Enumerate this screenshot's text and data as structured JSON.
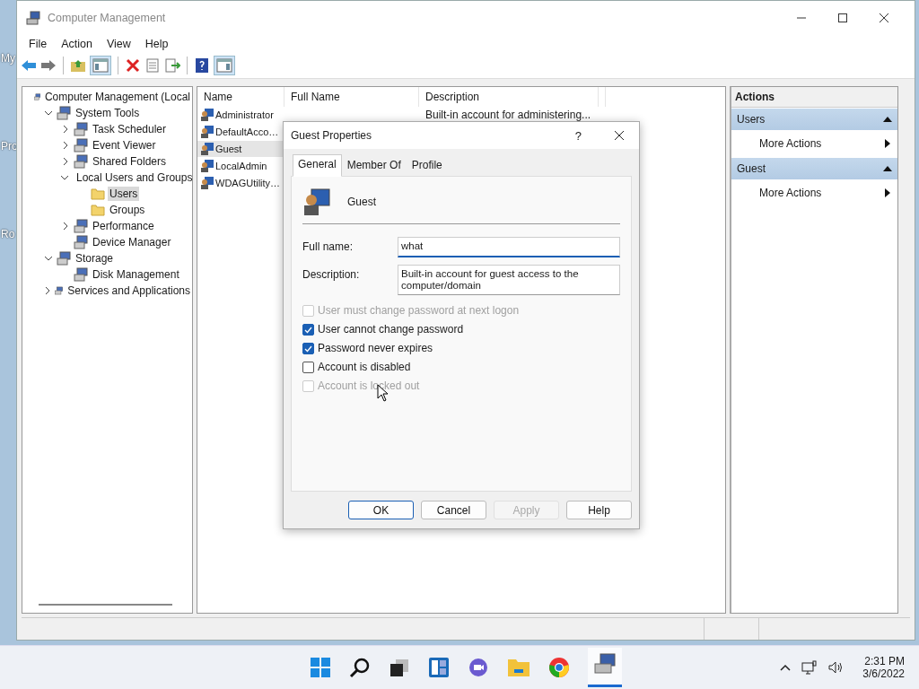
{
  "desktop_icons": [
    {
      "label": "My"
    },
    {
      "label": "Pro"
    },
    {
      "label": "Ro"
    }
  ],
  "window": {
    "title": "Computer Management"
  },
  "menu": [
    "File",
    "Action",
    "View",
    "Help"
  ],
  "tree": [
    {
      "label": "Computer Management (Local",
      "selected": false,
      "children": [
        {
          "label": "System Tools",
          "expanded": true,
          "selected": false,
          "children": [
            {
              "label": "Task Scheduler",
              "expanded": false,
              "selected": false
            },
            {
              "label": "Event Viewer",
              "expanded": false,
              "selected": false
            },
            {
              "label": "Shared Folders",
              "expanded": false,
              "selected": false
            },
            {
              "label": "Local Users and Groups",
              "expanded": true,
              "selected": false,
              "children": [
                {
                  "label": "Users",
                  "selected": true
                },
                {
                  "label": "Groups",
                  "selected": false
                }
              ]
            },
            {
              "label": "Performance",
              "expanded": false,
              "selected": false
            },
            {
              "label": "Device Manager",
              "selected": false
            }
          ]
        },
        {
          "label": "Storage",
          "expanded": true,
          "selected": false,
          "children": [
            {
              "label": "Disk Management",
              "selected": false
            }
          ]
        },
        {
          "label": "Services and Applications",
          "expanded": false,
          "selected": false
        }
      ]
    }
  ],
  "list": {
    "columns": [
      "Name",
      "Full Name",
      "Description"
    ],
    "rows": [
      {
        "name": "Administrator",
        "description": "Built-in account for administering...",
        "selected": false
      },
      {
        "name": "DefaultAcco…",
        "selected": false
      },
      {
        "name": "Guest",
        "selected": true
      },
      {
        "name": "LocalAdmin",
        "selected": false
      },
      {
        "name": "WDAGUtility…",
        "selected": false
      }
    ]
  },
  "actions": {
    "title": "Actions",
    "sections": [
      {
        "title": "Users",
        "items": [
          "More Actions"
        ]
      },
      {
        "title": "Guest",
        "items": [
          "More Actions"
        ]
      }
    ]
  },
  "dialog": {
    "title": "Guest Properties",
    "help": "?",
    "tabs": [
      {
        "label": "General",
        "selected": true
      },
      {
        "label": "Member Of",
        "selected": false
      },
      {
        "label": "Profile",
        "selected": false
      }
    ],
    "user": "Guest",
    "fields": [
      {
        "label": "Full name:",
        "value": "what",
        "focused": true
      },
      {
        "label": "Description:",
        "value": "Built-in account for guest access to the computer/domain",
        "focused": false
      }
    ],
    "checks": [
      {
        "label": "User must change password at next logon",
        "checked": false,
        "disabled": true
      },
      {
        "label": "User cannot change password",
        "checked": true,
        "disabled": false
      },
      {
        "label": "Password never expires",
        "checked": true,
        "disabled": false
      },
      {
        "label": "Account is disabled",
        "checked": false,
        "disabled": false
      },
      {
        "label": "Account is locked out",
        "checked": false,
        "disabled": true
      }
    ],
    "buttons": [
      {
        "label": "OK",
        "default": true,
        "disabled": false
      },
      {
        "label": "Cancel",
        "default": false,
        "disabled": false
      },
      {
        "label": "Apply",
        "default": false,
        "disabled": true
      },
      {
        "label": "Help",
        "default": false,
        "disabled": false
      }
    ]
  },
  "taskbar": {
    "time": "2:31 PM",
    "date": "3/6/2022"
  }
}
